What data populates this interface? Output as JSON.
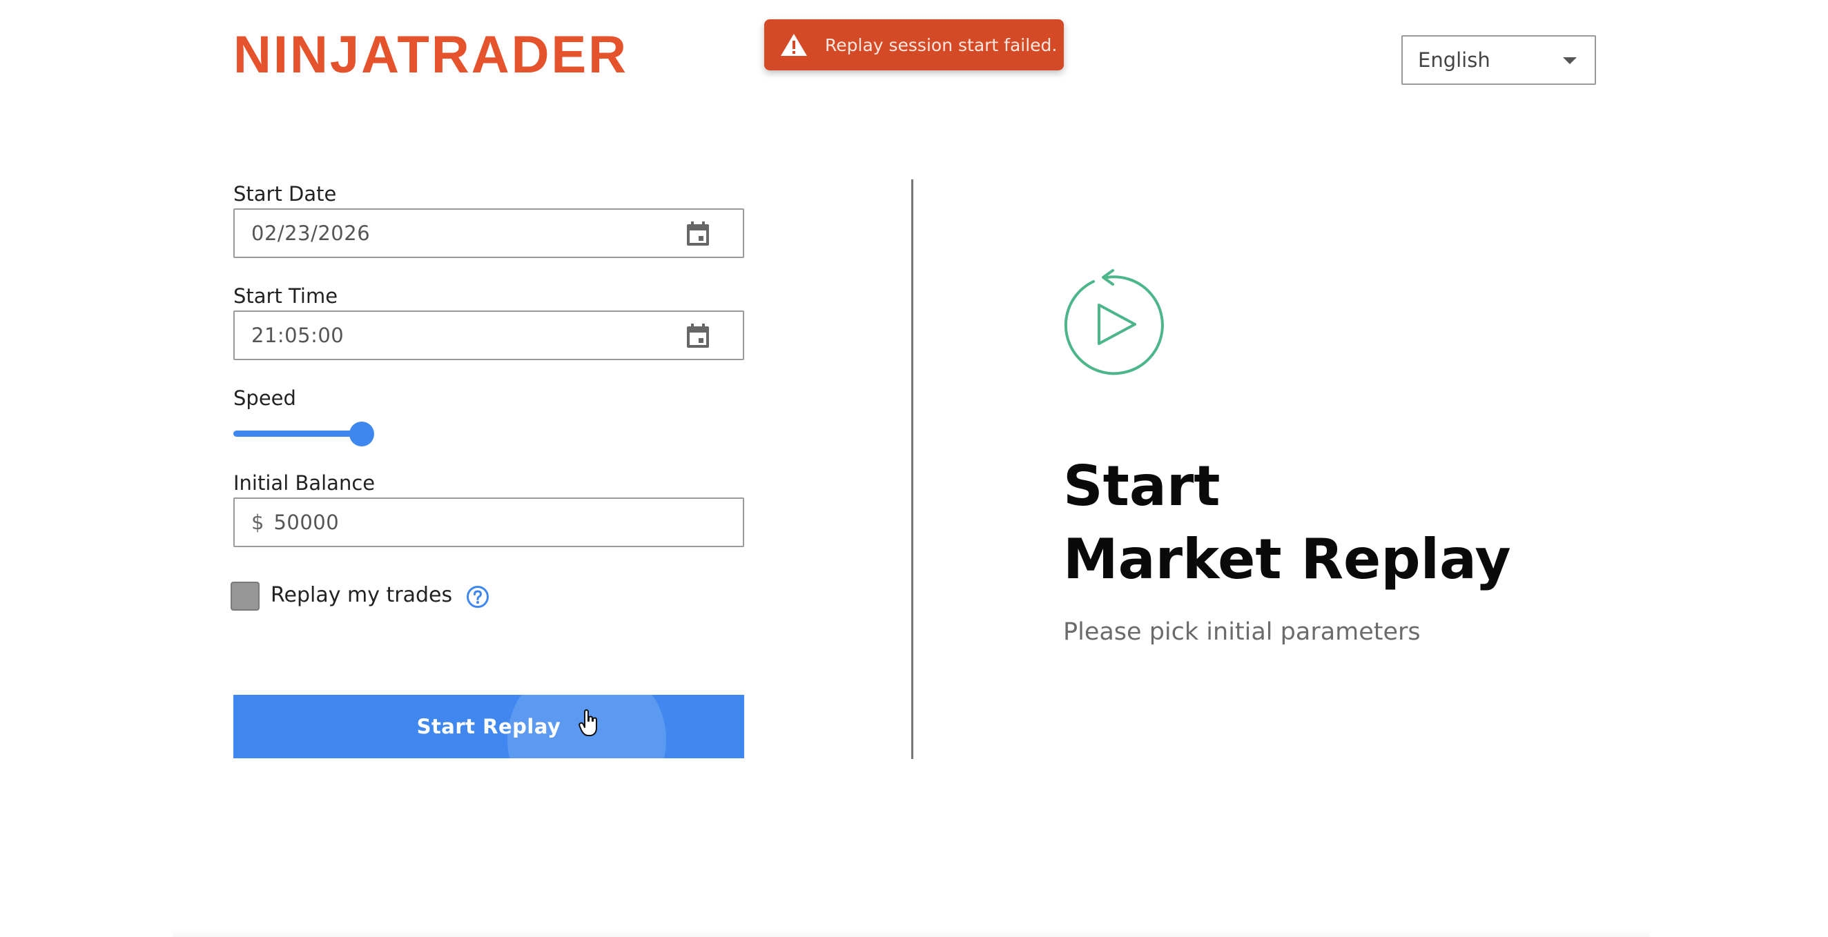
{
  "header": {
    "logo_text": "NINJATRADER",
    "language": "English"
  },
  "toast": {
    "message": "Replay session start failed.",
    "icon": "warning-icon"
  },
  "form": {
    "start_date_label": "Start Date",
    "start_date_value": "02/23/2026",
    "start_time_label": "Start Time",
    "start_time_value": "21:05:00",
    "speed_label": "Speed",
    "speed_level": 1.0,
    "initial_balance_label": "Initial Balance",
    "currency_prefix": "$",
    "initial_balance_value": "50000",
    "replay_trades_label": "Replay my trades",
    "replay_trades_checked": false,
    "submit_label": "Start Replay"
  },
  "hero": {
    "title_line1": "Start",
    "title_line2": "Market Replay",
    "subtitle": "Please pick initial parameters",
    "icon": "replay-play-icon"
  },
  "colors": {
    "brand": "#e5532d",
    "toast_bg": "#d44a26",
    "accent": "#4088ef",
    "replay_icon": "#4cb68a"
  }
}
